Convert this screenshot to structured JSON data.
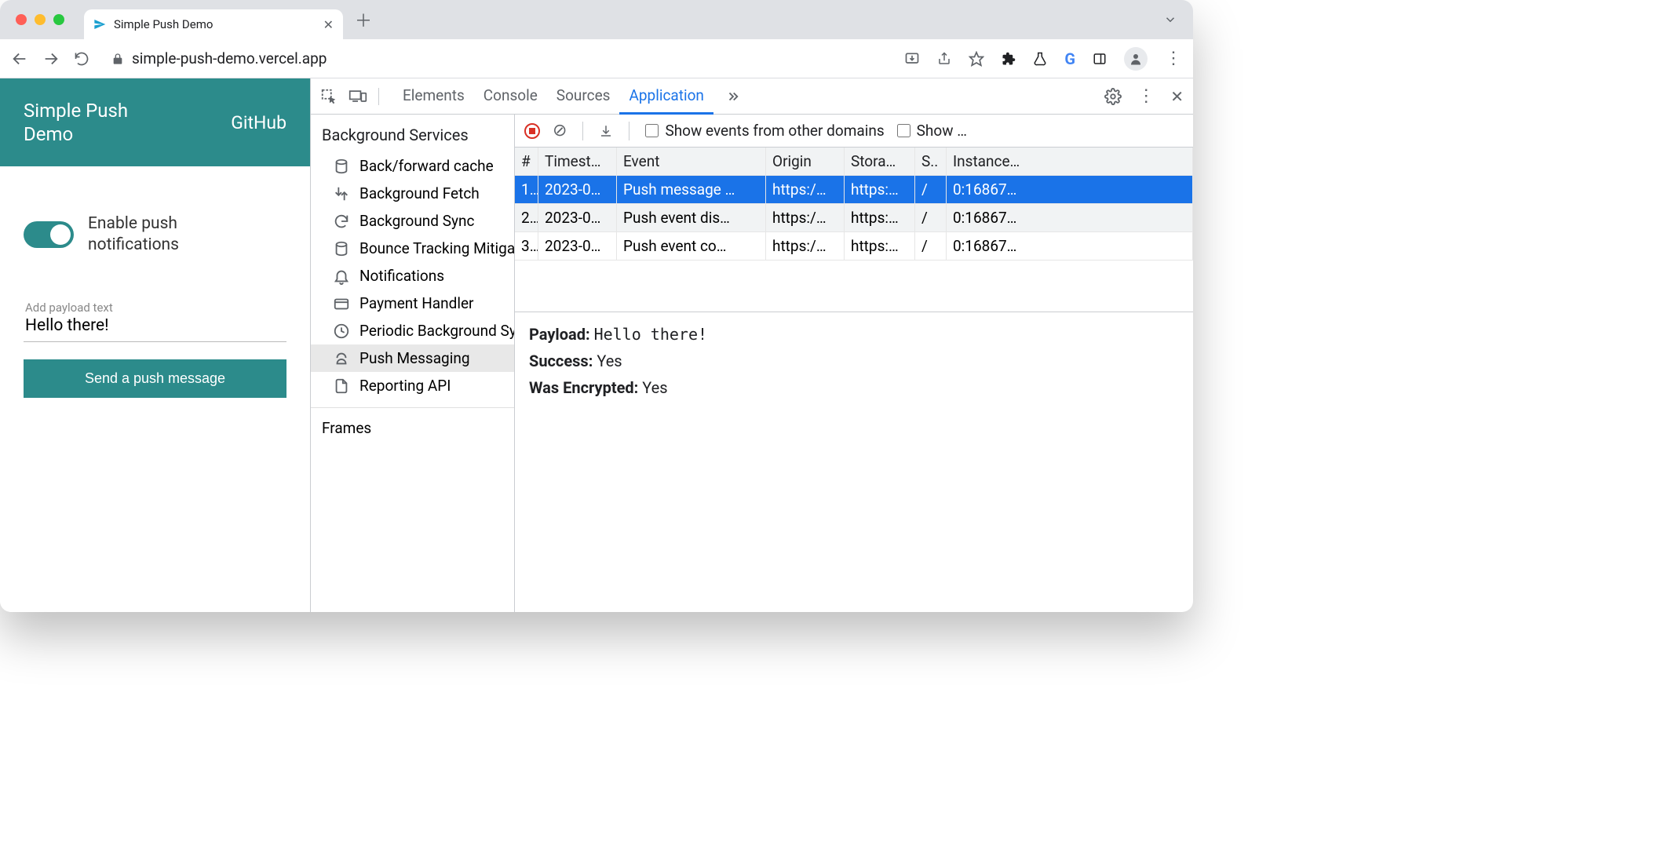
{
  "browser": {
    "tab_title": "Simple Push Demo",
    "url": "simple-push-demo.vercel.app"
  },
  "page": {
    "header_title": "Simple Push Demo",
    "header_link": "GitHub",
    "toggle_label": "Enable push notifications",
    "payload_placeholder": "Add payload text",
    "payload_value": "Hello there!",
    "send_button": "Send a push message"
  },
  "devtools": {
    "tabs": [
      "Elements",
      "Console",
      "Sources",
      "Application"
    ],
    "active_tab": "Application",
    "sidebar": {
      "group": "Background Services",
      "items": [
        "Back/forward cache",
        "Background Fetch",
        "Background Sync",
        "Bounce Tracking Mitigations",
        "Notifications",
        "Payment Handler",
        "Periodic Background Sync",
        "Push Messaging",
        "Reporting API"
      ],
      "selected": "Push Messaging",
      "frames_label": "Frames"
    },
    "toolbar": {
      "checkbox1": "Show events from other domains",
      "checkbox2": "Show …"
    },
    "table": {
      "headers": [
        "#",
        "Timest…",
        "Event",
        "Origin",
        "Stora…",
        "S..",
        "Instance…"
      ],
      "rows": [
        {
          "n": "1.",
          "ts": "2023-0…",
          "ev": "Push message …",
          "or": "https:/…",
          "st": "https:…",
          "sw": "/",
          "ins": "0:16867…",
          "sel": true
        },
        {
          "n": "2.",
          "ts": "2023-0…",
          "ev": "Push event dis…",
          "or": "https:/…",
          "st": "https:…",
          "sw": "/",
          "ins": "0:16867…",
          "alt": true
        },
        {
          "n": "3.",
          "ts": "2023-0…",
          "ev": "Push event co…",
          "or": "https:/…",
          "st": "https:…",
          "sw": "/",
          "ins": "0:16867…"
        }
      ]
    },
    "details": {
      "payload_k": "Payload:",
      "payload_v": "Hello there!",
      "success_k": "Success:",
      "success_v": "Yes",
      "enc_k": "Was Encrypted:",
      "enc_v": "Yes"
    }
  }
}
